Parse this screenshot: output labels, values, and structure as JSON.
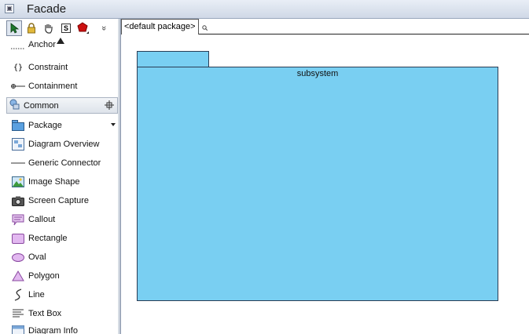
{
  "window": {
    "title": "Facade"
  },
  "palette": {
    "items_top": [
      {
        "label": "Anchor",
        "icon": "anchor-icon"
      },
      {
        "label": "Constraint",
        "icon": "constraint-icon"
      },
      {
        "label": "Containment",
        "icon": "containment-icon"
      }
    ],
    "section": {
      "label": "Common",
      "icon": "common-section-icon"
    },
    "items_common": [
      {
        "label": "Package",
        "icon": "package-icon"
      },
      {
        "label": "Diagram Overview",
        "icon": "diagram-overview-icon"
      },
      {
        "label": "Generic Connector",
        "icon": "generic-connector-icon"
      },
      {
        "label": "Image Shape",
        "icon": "image-shape-icon"
      },
      {
        "label": "Screen Capture",
        "icon": "screen-capture-icon"
      },
      {
        "label": "Callout",
        "icon": "callout-icon"
      },
      {
        "label": "Rectangle",
        "icon": "rectangle-icon"
      },
      {
        "label": "Oval",
        "icon": "oval-icon"
      },
      {
        "label": "Polygon",
        "icon": "polygon-icon"
      },
      {
        "label": "Line",
        "icon": "line-icon"
      },
      {
        "label": "Text Box",
        "icon": "text-box-icon"
      },
      {
        "label": "Diagram Info",
        "icon": "diagram-info-icon"
      }
    ],
    "toolbar": {
      "sticky_label": "S",
      "more_label": "»"
    }
  },
  "tabbar": {
    "active_tab": "<default package>"
  },
  "canvas": {
    "package_name": "subsystem",
    "package_color": "#79cff2"
  }
}
